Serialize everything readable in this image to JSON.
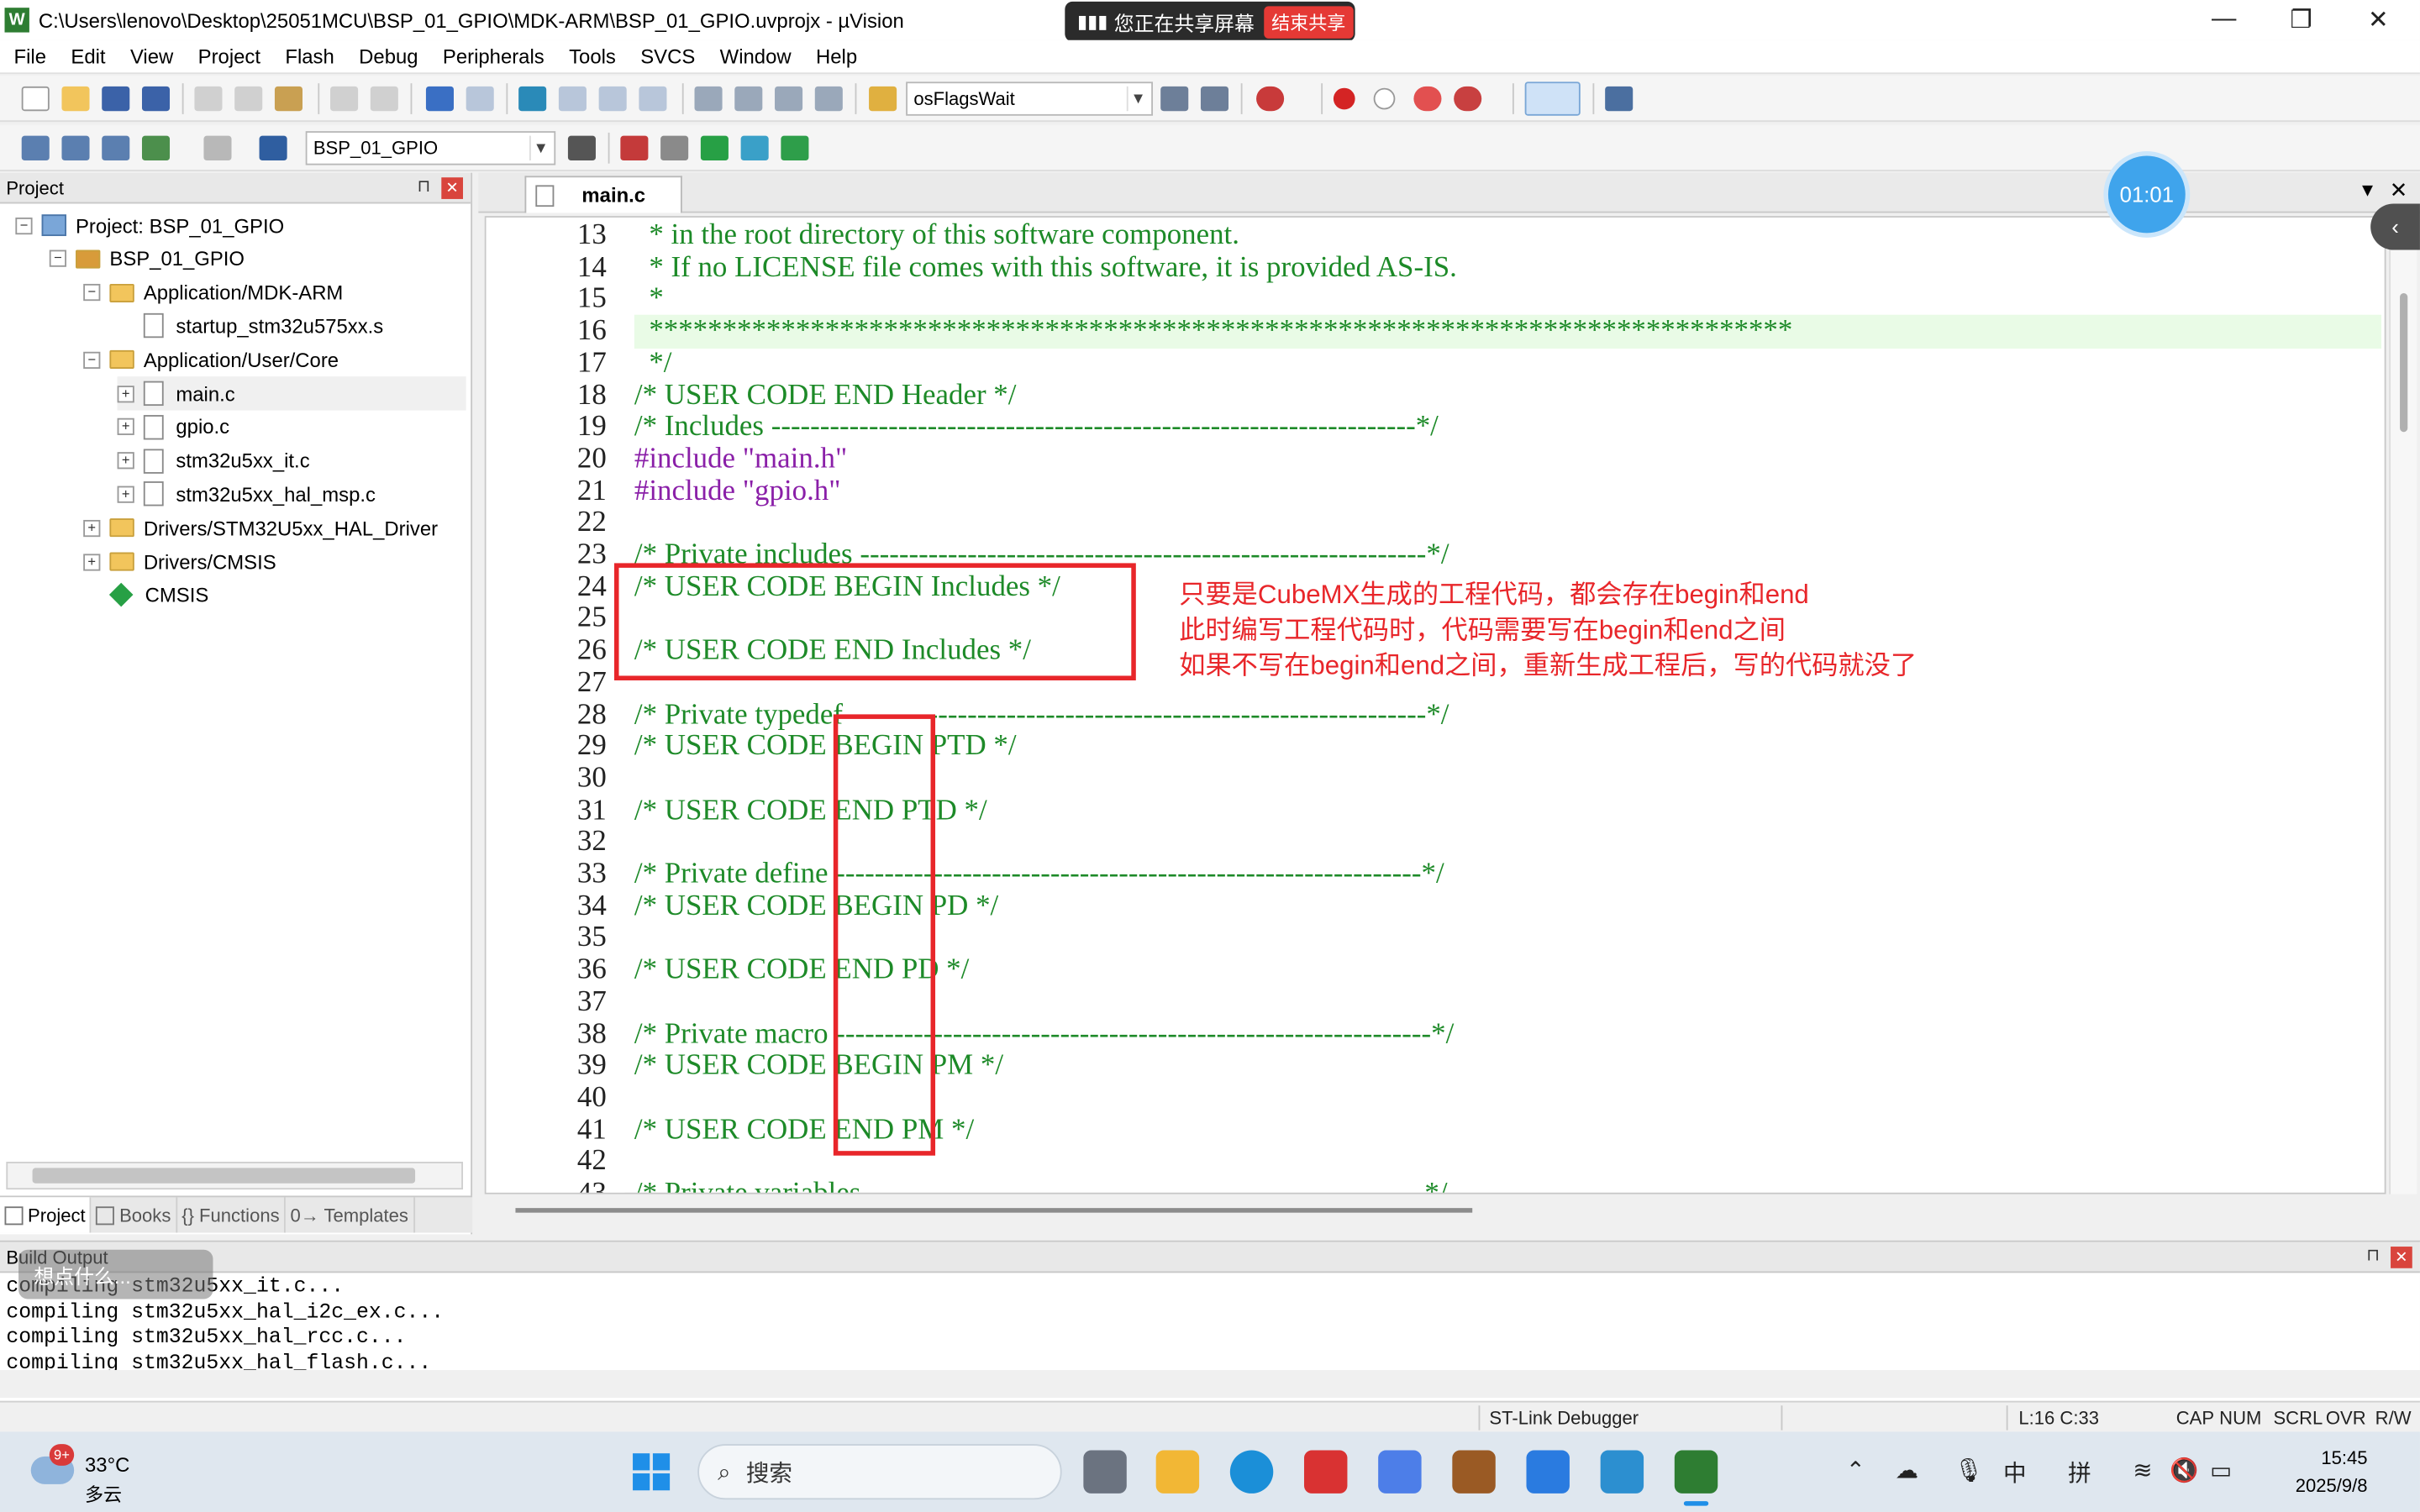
{
  "window": {
    "title": "C:\\Users\\lenovo\\Desktop\\25051MCU\\BSP_01_GPIO\\MDK-ARM\\BSP_01_GPIO.uvprojx - µVision",
    "app_icon": "W",
    "minimize": "—",
    "restore": "❐",
    "close": "✕"
  },
  "screen_share": {
    "status": "您正在共享屏幕",
    "end_button": "结束共享"
  },
  "menu": [
    "File",
    "Edit",
    "View",
    "Project",
    "Flash",
    "Debug",
    "Peripherals",
    "Tools",
    "SVCS",
    "Window",
    "Help"
  ],
  "toolbar": {
    "find_combo": "osFlagsWait",
    "target_combo": "BSP_01_GPIO"
  },
  "project_panel": {
    "title": "Project",
    "pin": "⊓",
    "close": "✕",
    "tree": [
      {
        "label": "Project: BSP_01_GPIO",
        "expander": "−",
        "icon": "project-icon"
      },
      {
        "label": "BSP_01_GPIO",
        "expander": "−",
        "icon": "target-icon"
      },
      {
        "label": "Application/MDK-ARM",
        "expander": "−",
        "icon": "folder-icon"
      },
      {
        "label": "startup_stm32u575xx.s",
        "expander": "",
        "icon": "file-icon"
      },
      {
        "label": "Application/User/Core",
        "expander": "−",
        "icon": "folder-icon"
      },
      {
        "label": "main.c",
        "expander": "+",
        "icon": "file-icon"
      },
      {
        "label": "gpio.c",
        "expander": "+",
        "icon": "file-icon"
      },
      {
        "label": "stm32u5xx_it.c",
        "expander": "+",
        "icon": "file-icon"
      },
      {
        "label": "stm32u5xx_hal_msp.c",
        "expander": "+",
        "icon": "file-icon"
      },
      {
        "label": "Drivers/STM32U5xx_HAL_Driver",
        "expander": "+",
        "icon": "folder-icon"
      },
      {
        "label": "Drivers/CMSIS",
        "expander": "+",
        "icon": "folder-icon"
      },
      {
        "label": "CMSIS",
        "expander": "",
        "icon": "cmsis-diamond-icon"
      }
    ],
    "bottom_tabs": [
      "Project",
      "Books",
      "{} Functions",
      "0→ Templates"
    ]
  },
  "editor": {
    "tab": "main.c",
    "tab_menu": "▼",
    "tab_close": "✕",
    "timer": "01:01",
    "collapse": "‹",
    "lines": [
      {
        "n": "13",
        "text": "  * in the root directory of this software component.",
        "kind": "comment"
      },
      {
        "n": "14",
        "text": "  * If no LICENSE file comes with this software, it is provided AS-IS.",
        "kind": "comment"
      },
      {
        "n": "15",
        "text": "  *",
        "kind": "comment"
      },
      {
        "n": "16",
        "text": "  ******************************************************************************",
        "kind": "comment",
        "highlight": true
      },
      {
        "n": "17",
        "text": "  */",
        "kind": "comment"
      },
      {
        "n": "18",
        "text": "/* USER CODE END Header */",
        "kind": "comment"
      },
      {
        "n": "19",
        "text": "/* Includes ------------------------------------------------------------------*/",
        "kind": "comment"
      },
      {
        "n": "20",
        "pre": "#include ",
        "str": "\"main.h\"",
        "kind": "include"
      },
      {
        "n": "21",
        "pre": "#include ",
        "str": "\"gpio.h\"",
        "kind": "include"
      },
      {
        "n": "22",
        "text": "",
        "kind": "comment"
      },
      {
        "n": "23",
        "text": "/* Private includes ----------------------------------------------------------*/",
        "kind": "comment"
      },
      {
        "n": "24",
        "text": "/* USER CODE BEGIN Includes */",
        "kind": "comment"
      },
      {
        "n": "25",
        "text": "",
        "kind": "comment"
      },
      {
        "n": "26",
        "text": "/* USER CODE END Includes */",
        "kind": "comment"
      },
      {
        "n": "27",
        "text": "",
        "kind": "comment"
      },
      {
        "n": "28",
        "text": "/* Private typedef -----------------------------------------------------------*/",
        "kind": "comment"
      },
      {
        "n": "29",
        "text": "/* USER CODE BEGIN PTD */",
        "kind": "comment"
      },
      {
        "n": "30",
        "text": "",
        "kind": "comment"
      },
      {
        "n": "31",
        "text": "/* USER CODE END PTD */",
        "kind": "comment"
      },
      {
        "n": "32",
        "text": "",
        "kind": "comment"
      },
      {
        "n": "33",
        "text": "/* Private define ------------------------------------------------------------*/",
        "kind": "comment"
      },
      {
        "n": "34",
        "text": "/* USER CODE BEGIN PD */",
        "kind": "comment"
      },
      {
        "n": "35",
        "text": "",
        "kind": "comment"
      },
      {
        "n": "36",
        "text": "/* USER CODE END PD */",
        "kind": "comment"
      },
      {
        "n": "37",
        "text": "",
        "kind": "comment"
      },
      {
        "n": "38",
        "text": "/* Private macro -------------------------------------------------------------*/",
        "kind": "comment"
      },
      {
        "n": "39",
        "text": "/* USER CODE BEGIN PM */",
        "kind": "comment"
      },
      {
        "n": "40",
        "text": "",
        "kind": "comment"
      },
      {
        "n": "41",
        "text": "/* USER CODE END PM */",
        "kind": "comment"
      },
      {
        "n": "42",
        "text": "",
        "kind": "comment"
      },
      {
        "n": "43",
        "text": "/* Private variables ---------------------------------------------------------*/",
        "kind": "comment"
      }
    ],
    "annotation": [
      "只要是CubeMX生成的工程代码，都会存在begin和end",
      "此时编写工程代码时，代码需要写在begin和end之间",
      "如果不写在begin和end之间，重新生成工程后，写的代码就没了"
    ]
  },
  "build_output": {
    "title": "Build Output",
    "overlay_hint": "想点什么...",
    "lines": [
      "compiling stm32u5xx_it.c...",
      "compiling stm32u5xx_hal_i2c_ex.c...",
      "compiling stm32u5xx_hal_rcc.c...",
      "compiling stm32u5xx_hal_flash.c..."
    ]
  },
  "status_bar": {
    "debugger": "ST-Link Debugger",
    "position": "L:16 C:33",
    "flags": [
      "CAP",
      "NUM",
      "SCRL",
      "OVR",
      "R/W"
    ]
  },
  "taskbar": {
    "weather_badge": "9+",
    "temperature": "33°C",
    "weather": "多云",
    "search": "搜索",
    "ime_lang": "中",
    "ime_mode": "拼",
    "time": "15:45",
    "date": "2025/9/8"
  },
  "colors": {
    "comment": "#1d8a28",
    "preprocessor": "#8a1fa8",
    "annotation": "#e8262a",
    "highlight_line": "#e9fbe6"
  }
}
